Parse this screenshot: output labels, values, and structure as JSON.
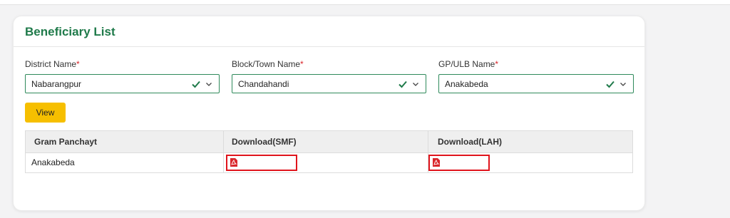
{
  "card": {
    "title": "Beneficiary List"
  },
  "filters": {
    "district": {
      "label": "District Name",
      "required_mark": "*",
      "value": "Nabarangpur"
    },
    "block": {
      "label": "Block/Town Name",
      "required_mark": "*",
      "value": "Chandahandi"
    },
    "gp": {
      "label": "GP/ULB Name",
      "required_mark": "*",
      "value": "Anakabeda"
    }
  },
  "actions": {
    "view_label": "View"
  },
  "table": {
    "headers": [
      "Gram Panchayt",
      "Download(SMF)",
      "Download(LAH)"
    ],
    "rows": [
      {
        "gram_panchayat": "Anakabeda",
        "smf_icon": "pdf-icon",
        "lah_icon": "pdf-icon"
      }
    ]
  },
  "colors": {
    "title_green": "#1f7a4a",
    "select_border": "#2f8a5b",
    "check_green": "#1f7a4a",
    "button_yellow": "#f6bf00",
    "highlight_red": "#e0141c",
    "pdf_red": "#d9252a"
  }
}
